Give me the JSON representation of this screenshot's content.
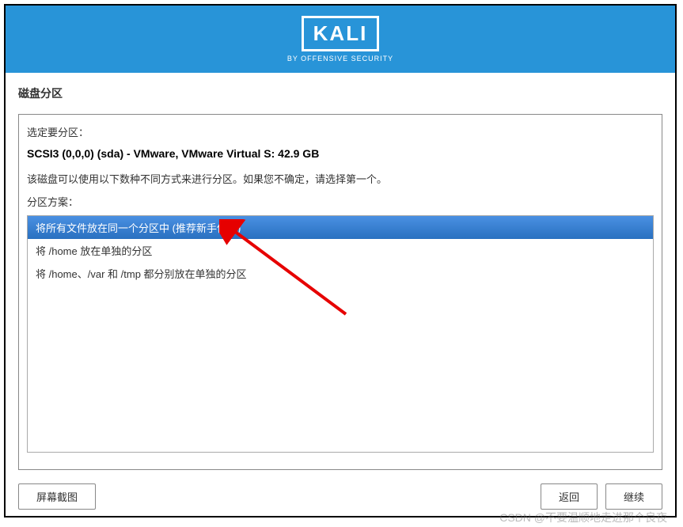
{
  "header": {
    "logo_text": "KALI",
    "subtitle": "BY OFFENSIVE SECURITY"
  },
  "section_title": "磁盘分区",
  "panel": {
    "selected_label": "选定要分区：",
    "disk_info": "SCSI3 (0,0,0) (sda) - VMware, VMware Virtual S: 42.9 GB",
    "description": "该磁盘可以使用以下数种不同方式来进行分区。如果您不确定，请选择第一个。",
    "scheme_label": "分区方案：",
    "options": [
      "将所有文件放在同一个分区中 (推荐新手使用)",
      "将 /home 放在单独的分区",
      "将 /home、/var 和 /tmp 都分别放在单独的分区"
    ]
  },
  "buttons": {
    "screenshot": "屏幕截图",
    "back": "返回",
    "continue": "继续"
  },
  "watermark": "CSDN @不要温顺地走进那个良夜"
}
